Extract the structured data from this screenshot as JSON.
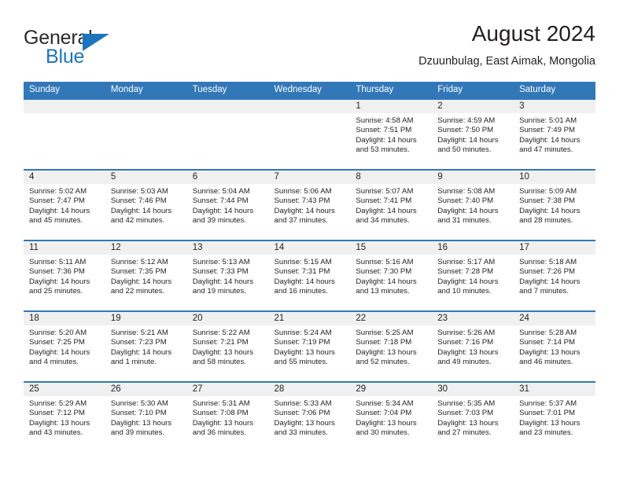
{
  "brand": {
    "name_top": "General",
    "name_bottom": "Blue",
    "accent_color": "#1b75bc",
    "triangle_icon": "brand-triangle-icon"
  },
  "header": {
    "title": "August 2024",
    "subtitle": "Dzuunbulag, East Aimak, Mongolia"
  },
  "theme": {
    "header_blue": "#3278b9",
    "daynum_band": "#f0f0f0",
    "text": "#231f20"
  },
  "weekdays": [
    "Sunday",
    "Monday",
    "Tuesday",
    "Wednesday",
    "Thursday",
    "Friday",
    "Saturday"
  ],
  "labels": {
    "sunrise": "Sunrise:",
    "sunset": "Sunset:",
    "daylight": "Daylight:"
  },
  "weeks": [
    [
      {
        "day": "",
        "empty": true
      },
      {
        "day": "",
        "empty": true
      },
      {
        "day": "",
        "empty": true
      },
      {
        "day": "",
        "empty": true
      },
      {
        "day": "1",
        "sunrise": "Sunrise: 4:58 AM",
        "sunset": "Sunset: 7:51 PM",
        "daylight": "Daylight: 14 hours and 53 minutes."
      },
      {
        "day": "2",
        "sunrise": "Sunrise: 4:59 AM",
        "sunset": "Sunset: 7:50 PM",
        "daylight": "Daylight: 14 hours and 50 minutes."
      },
      {
        "day": "3",
        "sunrise": "Sunrise: 5:01 AM",
        "sunset": "Sunset: 7:49 PM",
        "daylight": "Daylight: 14 hours and 47 minutes."
      }
    ],
    [
      {
        "day": "4",
        "sunrise": "Sunrise: 5:02 AM",
        "sunset": "Sunset: 7:47 PM",
        "daylight": "Daylight: 14 hours and 45 minutes."
      },
      {
        "day": "5",
        "sunrise": "Sunrise: 5:03 AM",
        "sunset": "Sunset: 7:46 PM",
        "daylight": "Daylight: 14 hours and 42 minutes."
      },
      {
        "day": "6",
        "sunrise": "Sunrise: 5:04 AM",
        "sunset": "Sunset: 7:44 PM",
        "daylight": "Daylight: 14 hours and 39 minutes."
      },
      {
        "day": "7",
        "sunrise": "Sunrise: 5:06 AM",
        "sunset": "Sunset: 7:43 PM",
        "daylight": "Daylight: 14 hours and 37 minutes."
      },
      {
        "day": "8",
        "sunrise": "Sunrise: 5:07 AM",
        "sunset": "Sunset: 7:41 PM",
        "daylight": "Daylight: 14 hours and 34 minutes."
      },
      {
        "day": "9",
        "sunrise": "Sunrise: 5:08 AM",
        "sunset": "Sunset: 7:40 PM",
        "daylight": "Daylight: 14 hours and 31 minutes."
      },
      {
        "day": "10",
        "sunrise": "Sunrise: 5:09 AM",
        "sunset": "Sunset: 7:38 PM",
        "daylight": "Daylight: 14 hours and 28 minutes."
      }
    ],
    [
      {
        "day": "11",
        "sunrise": "Sunrise: 5:11 AM",
        "sunset": "Sunset: 7:36 PM",
        "daylight": "Daylight: 14 hours and 25 minutes."
      },
      {
        "day": "12",
        "sunrise": "Sunrise: 5:12 AM",
        "sunset": "Sunset: 7:35 PM",
        "daylight": "Daylight: 14 hours and 22 minutes."
      },
      {
        "day": "13",
        "sunrise": "Sunrise: 5:13 AM",
        "sunset": "Sunset: 7:33 PM",
        "daylight": "Daylight: 14 hours and 19 minutes."
      },
      {
        "day": "14",
        "sunrise": "Sunrise: 5:15 AM",
        "sunset": "Sunset: 7:31 PM",
        "daylight": "Daylight: 14 hours and 16 minutes."
      },
      {
        "day": "15",
        "sunrise": "Sunrise: 5:16 AM",
        "sunset": "Sunset: 7:30 PM",
        "daylight": "Daylight: 14 hours and 13 minutes."
      },
      {
        "day": "16",
        "sunrise": "Sunrise: 5:17 AM",
        "sunset": "Sunset: 7:28 PM",
        "daylight": "Daylight: 14 hours and 10 minutes."
      },
      {
        "day": "17",
        "sunrise": "Sunrise: 5:18 AM",
        "sunset": "Sunset: 7:26 PM",
        "daylight": "Daylight: 14 hours and 7 minutes."
      }
    ],
    [
      {
        "day": "18",
        "sunrise": "Sunrise: 5:20 AM",
        "sunset": "Sunset: 7:25 PM",
        "daylight": "Daylight: 14 hours and 4 minutes."
      },
      {
        "day": "19",
        "sunrise": "Sunrise: 5:21 AM",
        "sunset": "Sunset: 7:23 PM",
        "daylight": "Daylight: 14 hours and 1 minute."
      },
      {
        "day": "20",
        "sunrise": "Sunrise: 5:22 AM",
        "sunset": "Sunset: 7:21 PM",
        "daylight": "Daylight: 13 hours and 58 minutes."
      },
      {
        "day": "21",
        "sunrise": "Sunrise: 5:24 AM",
        "sunset": "Sunset: 7:19 PM",
        "daylight": "Daylight: 13 hours and 55 minutes."
      },
      {
        "day": "22",
        "sunrise": "Sunrise: 5:25 AM",
        "sunset": "Sunset: 7:18 PM",
        "daylight": "Daylight: 13 hours and 52 minutes."
      },
      {
        "day": "23",
        "sunrise": "Sunrise: 5:26 AM",
        "sunset": "Sunset: 7:16 PM",
        "daylight": "Daylight: 13 hours and 49 minutes."
      },
      {
        "day": "24",
        "sunrise": "Sunrise: 5:28 AM",
        "sunset": "Sunset: 7:14 PM",
        "daylight": "Daylight: 13 hours and 46 minutes."
      }
    ],
    [
      {
        "day": "25",
        "sunrise": "Sunrise: 5:29 AM",
        "sunset": "Sunset: 7:12 PM",
        "daylight": "Daylight: 13 hours and 43 minutes."
      },
      {
        "day": "26",
        "sunrise": "Sunrise: 5:30 AM",
        "sunset": "Sunset: 7:10 PM",
        "daylight": "Daylight: 13 hours and 39 minutes."
      },
      {
        "day": "27",
        "sunrise": "Sunrise: 5:31 AM",
        "sunset": "Sunset: 7:08 PM",
        "daylight": "Daylight: 13 hours and 36 minutes."
      },
      {
        "day": "28",
        "sunrise": "Sunrise: 5:33 AM",
        "sunset": "Sunset: 7:06 PM",
        "daylight": "Daylight: 13 hours and 33 minutes."
      },
      {
        "day": "29",
        "sunrise": "Sunrise: 5:34 AM",
        "sunset": "Sunset: 7:04 PM",
        "daylight": "Daylight: 13 hours and 30 minutes."
      },
      {
        "day": "30",
        "sunrise": "Sunrise: 5:35 AM",
        "sunset": "Sunset: 7:03 PM",
        "daylight": "Daylight: 13 hours and 27 minutes."
      },
      {
        "day": "31",
        "sunrise": "Sunrise: 5:37 AM",
        "sunset": "Sunset: 7:01 PM",
        "daylight": "Daylight: 13 hours and 23 minutes."
      }
    ]
  ]
}
